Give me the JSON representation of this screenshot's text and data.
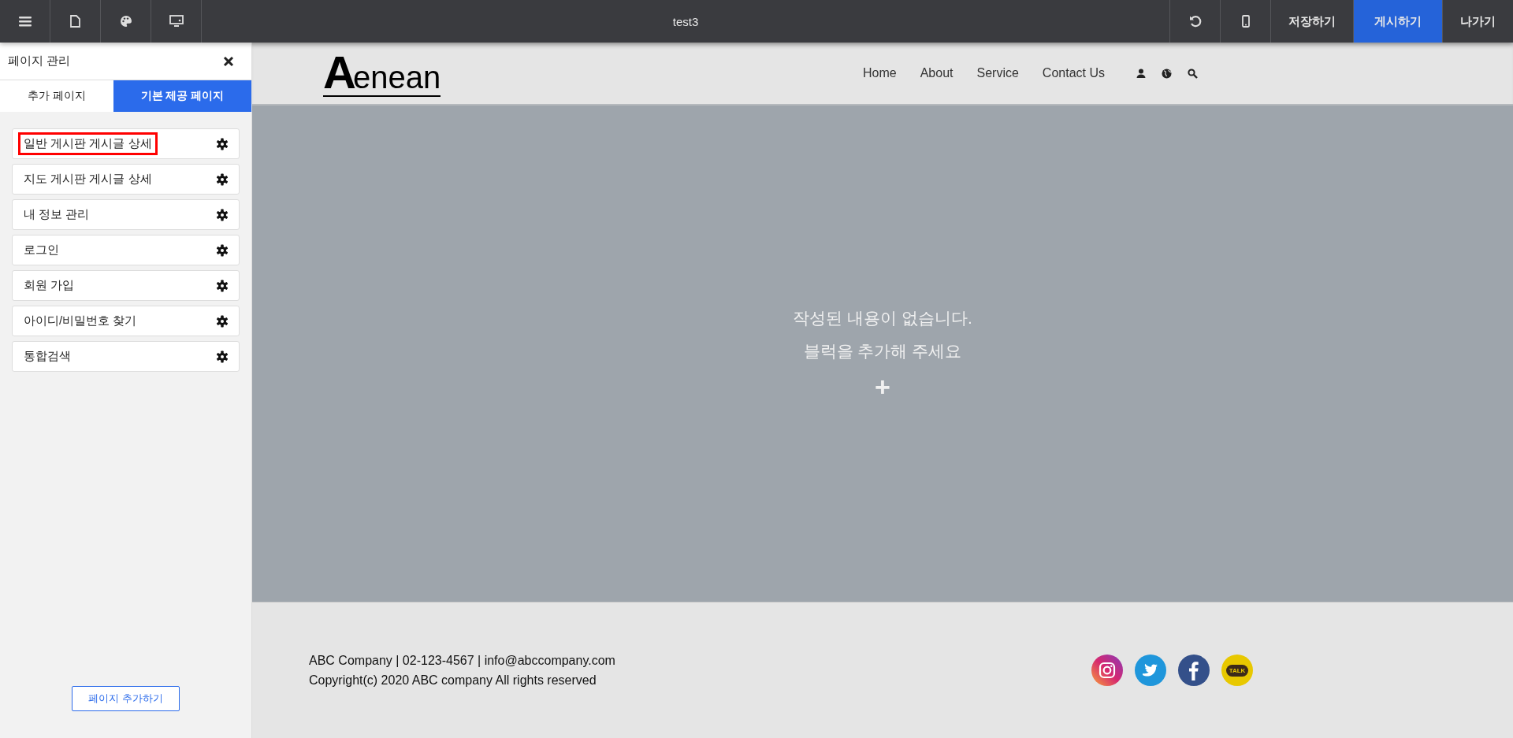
{
  "toolbar": {
    "title": "test3",
    "actions": [
      {
        "label": "저장하기",
        "primary": false
      },
      {
        "label": "게시하기",
        "primary": true
      },
      {
        "label": "나가기",
        "primary": false
      }
    ]
  },
  "sidebar": {
    "title": "페이지 관리",
    "tabs": [
      {
        "label": "추가 페이지",
        "selected": false
      },
      {
        "label": "기본 제공 페이지",
        "selected": true
      }
    ],
    "pages": [
      {
        "label": "일반 게시판 게시글 상세",
        "selected": true
      },
      {
        "label": "지도 게시판 게시글 상세",
        "selected": false
      },
      {
        "label": "내 정보 관리",
        "selected": false
      },
      {
        "label": "로그인",
        "selected": false
      },
      {
        "label": "회원 가입",
        "selected": false
      },
      {
        "label": "아이디/비밀번호 찾기",
        "selected": false
      },
      {
        "label": "통합검색",
        "selected": false
      }
    ],
    "add_button": "페이지 추가하기"
  },
  "site": {
    "logo_initial": "A",
    "logo_rest": "enean",
    "nav": [
      "Home",
      "About",
      "Service",
      "Contact Us"
    ],
    "empty_message": [
      "작성된 내용이 없습니다.",
      "블럭을 추가해 주세요"
    ],
    "add_symbol": "+",
    "footer": {
      "lines": [
        "ABC Company | 02-123-4567 | info@abccompany.com",
        "Copyright(c) 2020 ABC company All rights reserved"
      ],
      "talk_label": "TALK"
    }
  }
}
